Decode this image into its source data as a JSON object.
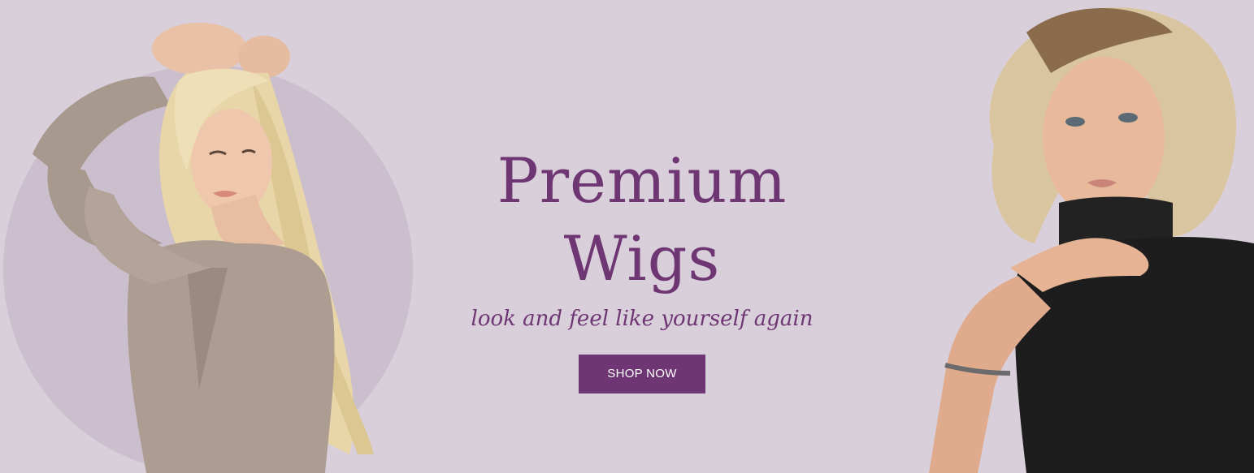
{
  "hero": {
    "headline": "Premium Wigs",
    "tagline": "look and feel like yourself again",
    "cta_label": "SHOP NOW"
  },
  "colors": {
    "background": "#d9cfdb",
    "circle": "#cbbfce",
    "accent": "#6e3672",
    "button_text": "#ffffff"
  },
  "images": {
    "left": "model-blonde-long-hair-photo",
    "right": "model-curly-blonde-bob-photo"
  }
}
